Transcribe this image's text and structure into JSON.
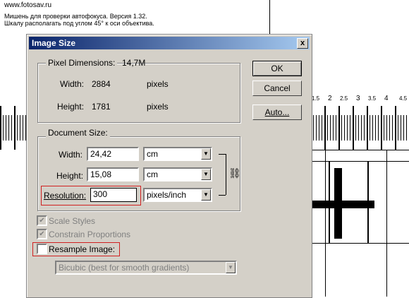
{
  "background": {
    "site": "www.fotosav.ru",
    "line1": "Мишень для проверки автофокуса. Версия 1.32.",
    "line2": "Шкалу располагать под углом 45° к оси объектива.",
    "ruler_labels": [
      "1.5",
      "2",
      "2.5",
      "3",
      "3.5",
      "4",
      "4.5"
    ]
  },
  "dialog": {
    "title": "Image Size",
    "close_glyph": "x",
    "pixel_dimensions": {
      "title": "Pixel Dimensions:",
      "size": "14,7M",
      "width_label": "Width:",
      "width_value": "2884",
      "width_unit": "pixels",
      "height_label": "Height:",
      "height_value": "1781",
      "height_unit": "pixels"
    },
    "document_size": {
      "title": "Document Size:",
      "width_label": "Width:",
      "width_value": "24,42",
      "width_unit": "cm",
      "height_label": "Height:",
      "height_value": "15,08",
      "height_unit": "cm",
      "resolution_label": "Resolution:",
      "resolution_value": "300",
      "resolution_unit": "pixels/inch"
    },
    "buttons": {
      "ok": "OK",
      "cancel": "Cancel",
      "auto": "Auto..."
    },
    "options": {
      "scale_styles": "Scale Styles",
      "scale_styles_checked": true,
      "constrain": "Constrain Proportions",
      "constrain_checked": true,
      "resample": "Resample Image:",
      "resample_checked": false,
      "method": "Bicubic (best for smooth gradients)"
    }
  },
  "colors": {
    "titlebar_start": "#0a246a",
    "titlebar_end": "#a6caf0",
    "highlight": "#d02020",
    "dialog_bg": "#d4d0c8"
  }
}
